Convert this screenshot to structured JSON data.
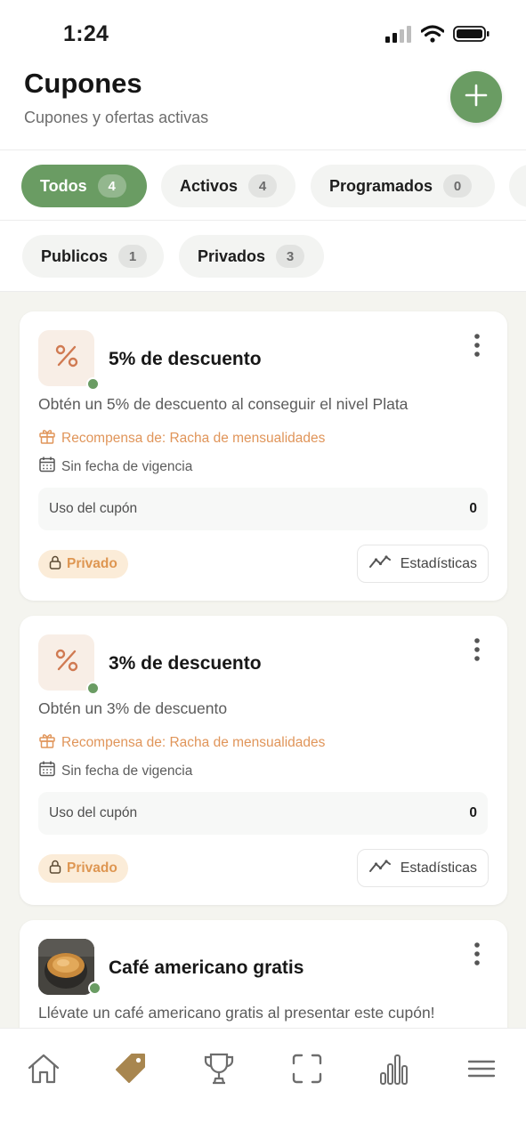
{
  "status_bar": {
    "time": "1:24",
    "icons": [
      "signal-icon",
      "wifi-icon",
      "battery-icon"
    ]
  },
  "header": {
    "title": "Cupones",
    "subtitle": "Cupones y ofertas activas",
    "add_button_icon": "plus-icon"
  },
  "status_filters": [
    {
      "label": "Todos",
      "count": "4",
      "active": true
    },
    {
      "label": "Activos",
      "count": "4",
      "active": false
    },
    {
      "label": "Programados",
      "count": "0",
      "active": false
    }
  ],
  "visibility_filters": [
    {
      "label": "Publicos",
      "count": "1"
    },
    {
      "label": "Privados",
      "count": "3"
    }
  ],
  "coupons": [
    {
      "title": "5% de descuento",
      "description": "Obtén un 5% de descuento al conseguir el nivel Plata",
      "reward": "Recompensa de: Racha de mensualidades",
      "validity": "Sin fecha de vigencia",
      "usage_label": "Uso del cupón",
      "usage_value": "0",
      "visibility": "Privado",
      "stats_label": "Estadísticas",
      "icon": "percent-icon"
    },
    {
      "title": "3% de descuento",
      "description": "Obtén un 3% de descuento",
      "reward": "Recompensa de: Racha de mensualidades",
      "validity": "Sin fecha de vigencia",
      "usage_label": "Uso del cupón",
      "usage_value": "0",
      "visibility": "Privado",
      "stats_label": "Estadísticas",
      "icon": "percent-icon"
    },
    {
      "title": "Café americano gratis",
      "description": "Llévate un café americano gratis al presentar este cupón!",
      "icon": "coffee-photo"
    }
  ],
  "tab_bar": [
    {
      "icon": "home-icon",
      "active": false
    },
    {
      "icon": "tag-icon",
      "active": true
    },
    {
      "icon": "trophy-icon",
      "active": false
    },
    {
      "icon": "scan-icon",
      "active": false
    },
    {
      "icon": "bar-chart-icon",
      "active": false
    },
    {
      "icon": "menu-icon",
      "active": false
    }
  ],
  "colors": {
    "accent_green": "#6a9c63",
    "reward_orange": "#e0955a",
    "badge_bg": "#fbecd8",
    "tab_active": "#a8864f",
    "list_bg": "#f4f4ef"
  }
}
